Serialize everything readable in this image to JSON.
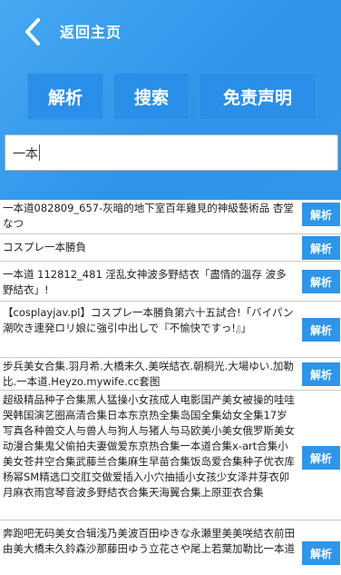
{
  "header": {
    "title": "返回主页"
  },
  "buttons": {
    "parse": "解析",
    "search": "搜索",
    "disclaimer": "免责声明"
  },
  "search": {
    "value": "一本"
  },
  "results": [
    {
      "title": "一本道082809_657-灰暗的地下室百年雞見的神級藝術品 杏堂なつ",
      "action": "解析"
    },
    {
      "title": "コスプレ一本勝負",
      "action": "解析"
    },
    {
      "title": "一本道 112812_481 淫乱女神波多野結衣「盡情的溫存 波多野結衣」!",
      "action": "解析"
    },
    {
      "title": "【cosplayjav.pl】コスプレ一本勝負第六十五試合!「バイパン潮吹き連発ロリ娘に強引中出しで『不愉快ですっ!』」",
      "action": "解析"
    },
    {
      "title": "步兵美女合集.羽月希.大橋未久.美咲結衣.朝桐光.大場ゆい.加勒比.一本道.Heyzo.mywife.cc套图",
      "action": "解析"
    },
    {
      "title": "超级精品种子合集黑人猛操小女孩成人电影国产美女被操的哇哇哭韩国演艺圈高清合集日本东京热全集岛国全集幼女全集17岁写真各种兽交人与兽人与狗人与猪人与马欧美小美女俄罗斯美女动漫合集鬼父偷拍夫妻做爱东京热合集一本道合集x-art合集小美女苍井空合集武藤兰合集麻生早苗合集饭岛爱合集种子优衣库杨幂SM精选口交肛交做爱插入小穴抽插小女孩少女泽井芽衣卯月麻衣雨宫琴音波多野結衣合集天海翼合集上原亚衣合集",
      "action": "解析"
    },
    {
      "title": "奔跑吧无码美女合辑浅乃美波百田ゆきな永瀬里美美咲結衣前田由美大橋未久鈴森沙那藤田ゆう立花さや尾上若葉加勒比一本道",
      "action": "解析"
    }
  ]
}
